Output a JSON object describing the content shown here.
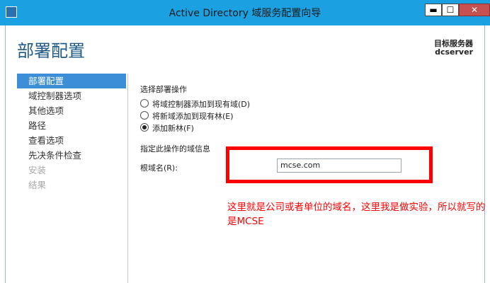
{
  "window": {
    "title": "Active Directory 域服务配置向导",
    "minimize": "▬",
    "maximize": "☐",
    "close": "✕"
  },
  "header": {
    "heading": "部署配置",
    "target_label": "目标服务器",
    "target_name": "dcserver"
  },
  "nav": {
    "items": [
      {
        "label": "部署配置",
        "state": "active"
      },
      {
        "label": "域控制器选项",
        "state": "normal"
      },
      {
        "label": "其他选项",
        "state": "normal"
      },
      {
        "label": "路径",
        "state": "normal"
      },
      {
        "label": "查看选项",
        "state": "normal"
      },
      {
        "label": "先决条件检查",
        "state": "normal"
      },
      {
        "label": "安装",
        "state": "disabled"
      },
      {
        "label": "结果",
        "state": "disabled"
      }
    ]
  },
  "deployment": {
    "section_label": "选择部署操作",
    "options": [
      {
        "label": "将域控制器添加到现有域(D)",
        "checked": false
      },
      {
        "label": "将新域添加到现有林(E)",
        "checked": false
      },
      {
        "label": "添加新林(F)",
        "checked": true
      }
    ]
  },
  "domain_info": {
    "section_label": "指定此操作的域信息",
    "root_label": "根域名(R):",
    "root_value": "mcse.com"
  },
  "annotation": {
    "text": "这里就是公司或者单位的域名，这里我是做实验，所以就写的是MCSE"
  },
  "colors": {
    "titlebar": "#1ba1e2",
    "heading": "#1e5a8a",
    "nav_active": "#3c8fd6",
    "annotation": "#ff0000"
  }
}
